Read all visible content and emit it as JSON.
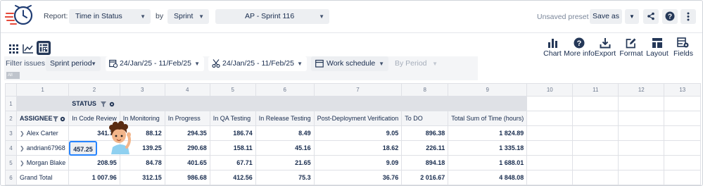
{
  "header": {
    "report_label": "Report:",
    "report_value": "Time in Status",
    "by_label": "by",
    "by_value": "Sprint",
    "sprint_value": "AP - Sprint 116",
    "unsaved": "Unsaved preset",
    "save_as": "Save as"
  },
  "tools": [
    {
      "label": "Chart",
      "icon": "bar-chart-icon"
    },
    {
      "label": "More info",
      "icon": "question-circle-icon"
    },
    {
      "label": "Export",
      "icon": "download-tray-icon"
    },
    {
      "label": "Format",
      "icon": "pencil-square-icon"
    },
    {
      "label": "Layout",
      "icon": "layout-icon"
    },
    {
      "label": "Fields",
      "icon": "fields-gear-icon"
    }
  ],
  "filters": {
    "label": "Filter issues:",
    "period": "Sprint period",
    "date_range_1": "24/Jan/25 - 11/Feb/25",
    "date_range_2": "24/Jan/25 - 11/Feb/25",
    "work_schedule": "Work schedule",
    "by_period": "By Period",
    "all_chip": "All"
  },
  "grid": {
    "col_numbers": [
      "1",
      "2",
      "3",
      "4",
      "5",
      "6",
      "7",
      "8",
      "9",
      "10",
      "11",
      "12",
      "13"
    ],
    "row_numbers": [
      "1",
      "2",
      "3",
      "4",
      "5",
      "6"
    ],
    "status_label": "STATUS",
    "assignee_label": "ASSIGNEE",
    "columns": [
      "In Code Review",
      "In Monitoring",
      "In Progress",
      "In QA Testing",
      "In Release Testing",
      "Post-Deployment Verification",
      "To DO",
      "Total Sum of Time (hours)"
    ],
    "rows": [
      {
        "name": "Alex Carter",
        "values": [
          "341.76",
          "88.12",
          "294.35",
          "186.74",
          "8.49",
          "9.05",
          "896.38",
          "1 824.89"
        ]
      },
      {
        "name": "andrian67968",
        "values": [
          "457.25",
          "139.25",
          "290.68",
          "158.11",
          "45.16",
          "18.62",
          "226.11",
          "1 335.18"
        ]
      },
      {
        "name": "Morgan Blake",
        "values": [
          "208.95",
          "84.78",
          "401.65",
          "67.71",
          "21.65",
          "9.09",
          "894.18",
          "1 688.01"
        ]
      }
    ],
    "total": {
      "name": "Grand Total",
      "values": [
        "1 007.96",
        "312.15",
        "986.68",
        "412.56",
        "75.3",
        "36.76",
        "2 016.67",
        "4 848.08"
      ]
    }
  },
  "colors": {
    "accent": "#2684ff",
    "active_view": "#253858",
    "logo_red": "#e5493a",
    "logo_blue": "#1f3c73"
  }
}
